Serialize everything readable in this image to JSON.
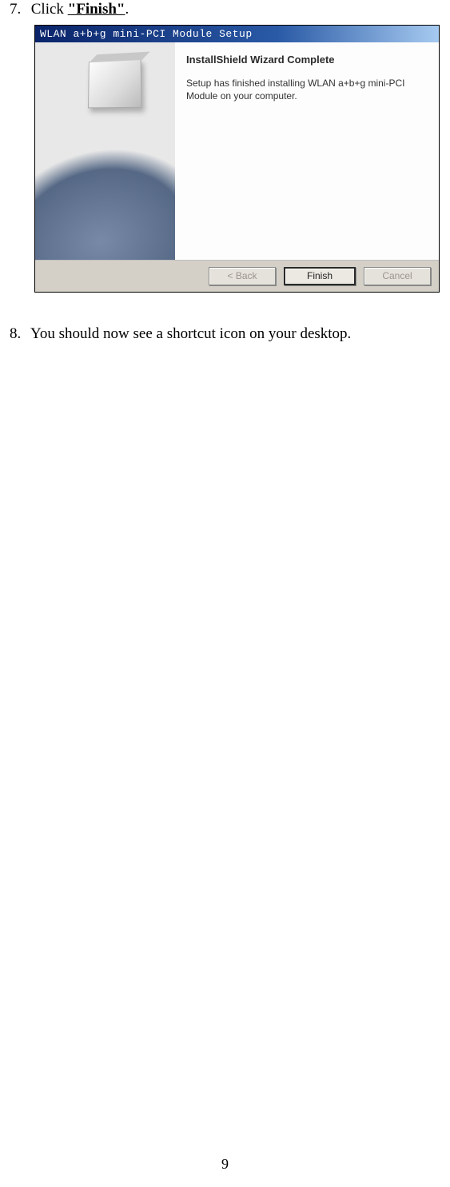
{
  "doc": {
    "step7_num": "7.",
    "step7_pre": "Click ",
    "step7_bold": "\"Finish\"",
    "step7_post": ".",
    "step8_num": "8.",
    "step8_text": "You should now see a shortcut icon on your desktop.",
    "page_number": "9"
  },
  "dialog": {
    "title": "WLAN a+b+g mini-PCI Module Setup",
    "heading": "InstallShield Wizard Complete",
    "body": "Setup has finished installing WLAN a+b+g mini-PCI Module on your computer.",
    "buttons": {
      "back": "< Back",
      "finish": "Finish",
      "cancel": "Cancel"
    }
  }
}
